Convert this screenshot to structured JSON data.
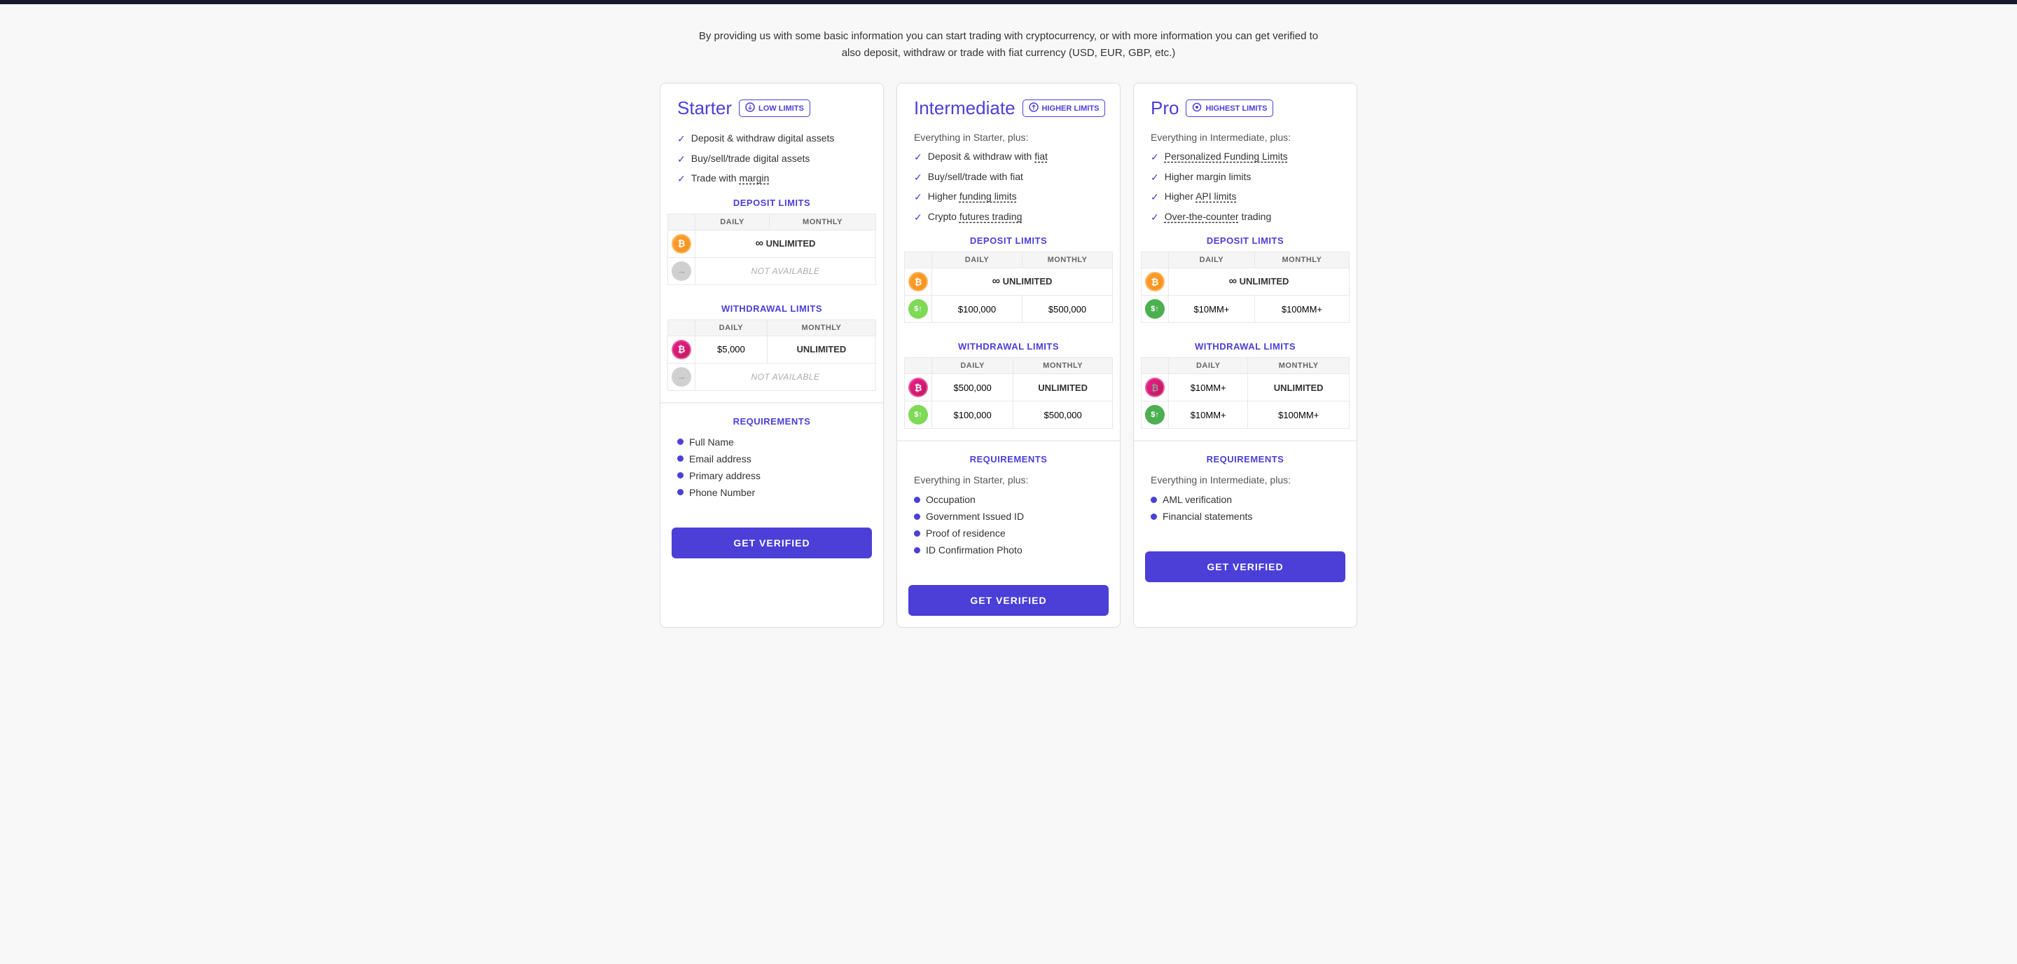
{
  "header": {
    "text": "By providing us with some basic information you can start trading with cryptocurrency, or with more information you can get verified to also deposit, withdraw or trade with fiat currency (USD, EUR, GBP, etc.)"
  },
  "cards": [
    {
      "id": "starter",
      "title": "Starter",
      "badge": "LOW LIMITS",
      "badge_icon": "↑",
      "features_prefix": null,
      "features": [
        "Deposit & withdraw digital assets",
        "Buy/sell/trade digital assets",
        "Trade with margin"
      ],
      "features_links": [
        null,
        null,
        "margin"
      ],
      "deposit_limits": {
        "title": "DEPOSIT LIMITS",
        "headers": [
          "DAILY",
          "MONTHLY"
        ],
        "rows": [
          {
            "icon": "btc-deposit",
            "icon_label": "₿",
            "daily": "∞ UNLIMITED",
            "monthly": null,
            "daily_type": "unlimited",
            "monthly_type": "merged"
          },
          {
            "icon": "grey",
            "icon_label": "→",
            "daily": "NOT AVAILABLE",
            "monthly": null,
            "daily_type": "not-available",
            "monthly_type": "merged"
          }
        ]
      },
      "withdrawal_limits": {
        "title": "WITHDRAWAL LIMITS",
        "headers": [
          "DAILY",
          "MONTHLY"
        ],
        "rows": [
          {
            "icon": "btc-withdraw",
            "icon_label": "₿",
            "daily": "$5,000",
            "monthly": "UNLIMITED",
            "daily_type": "amount",
            "monthly_type": "unlimited"
          },
          {
            "icon": "grey",
            "icon_label": "→",
            "daily": "NOT AVAILABLE",
            "monthly": null,
            "daily_type": "not-available",
            "monthly_type": "merged"
          }
        ]
      },
      "requirements": {
        "title": "REQUIREMENTS",
        "subtitle": null,
        "items": [
          "Full Name",
          "Email address",
          "Primary address",
          "Phone Number"
        ]
      },
      "button": "GET VERIFIED"
    },
    {
      "id": "intermediate",
      "title": "Intermediate",
      "badge": "HIGHER LIMITS",
      "badge_icon": "↑",
      "features_prefix": "Everything in Starter, plus:",
      "features": [
        "Deposit & withdraw with fiat",
        "Buy/sell/trade with fiat",
        "Higher funding limits",
        "Crypto futures trading"
      ],
      "features_links": [
        "fiat",
        null,
        "funding limits",
        "futures trading"
      ],
      "deposit_limits": {
        "title": "DEPOSIT LIMITS",
        "headers": [
          "DAILY",
          "MONTHLY"
        ],
        "rows": [
          {
            "icon": "btc-deposit",
            "icon_label": "₿",
            "daily": "∞ UNLIMITED",
            "monthly": null,
            "daily_type": "unlimited",
            "monthly_type": "merged"
          },
          {
            "icon": "fiat-deposit",
            "icon_label": "$",
            "daily": "$100,000",
            "monthly": "$500,000",
            "daily_type": "amount",
            "monthly_type": "amount"
          }
        ]
      },
      "withdrawal_limits": {
        "title": "WITHDRAWAL LIMITS",
        "headers": [
          "DAILY",
          "MONTHLY"
        ],
        "rows": [
          {
            "icon": "btc-withdraw",
            "icon_label": "₿",
            "daily": "$500,000",
            "monthly": "UNLIMITED",
            "daily_type": "amount",
            "monthly_type": "unlimited"
          },
          {
            "icon": "fiat-withdraw",
            "icon_label": "$",
            "daily": "$100,000",
            "monthly": "$500,000",
            "daily_type": "amount",
            "monthly_type": "amount"
          }
        ]
      },
      "requirements": {
        "title": "REQUIREMENTS",
        "subtitle": "Everything in Starter, plus:",
        "items": [
          "Occupation",
          "Government Issued ID",
          "Proof of residence",
          "ID Confirmation Photo"
        ]
      },
      "button": "GET VERIFIED"
    },
    {
      "id": "pro",
      "title": "Pro",
      "badge": "HIGHEST LIMITS",
      "badge_icon": "◎",
      "features_prefix": "Everything in Intermediate, plus:",
      "features": [
        "Personalized Funding Limits",
        "Higher margin limits",
        "Higher API limits",
        "Over-the-counter trading"
      ],
      "features_links": [
        "Personalized Funding Limits",
        null,
        "API limits",
        "Over-the-counter"
      ],
      "deposit_limits": {
        "title": "DEPOSIT LIMITS",
        "headers": [
          "DAILY",
          "MONTHLY"
        ],
        "rows": [
          {
            "icon": "btc-deposit",
            "icon_label": "₿",
            "daily": "∞ UNLIMITED",
            "monthly": null,
            "daily_type": "unlimited",
            "monthly_type": "merged"
          },
          {
            "icon": "fiat-deposit-pro",
            "icon_label": "$",
            "daily": "$10MM+",
            "monthly": "$100MM+",
            "daily_type": "amount",
            "monthly_type": "amount"
          }
        ]
      },
      "withdrawal_limits": {
        "title": "WITHDRAWAL LIMITS",
        "headers": [
          "DAILY",
          "MONTHLY"
        ],
        "rows": [
          {
            "icon": "btc-withdraw-pro",
            "icon_label": "₿",
            "daily": "$10MM+",
            "monthly": "UNLIMITED",
            "daily_type": "amount",
            "monthly_type": "unlimited"
          },
          {
            "icon": "fiat-withdraw-pro",
            "icon_label": "$",
            "daily": "$10MM+",
            "monthly": "$100MM+",
            "daily_type": "amount",
            "monthly_type": "amount"
          }
        ]
      },
      "requirements": {
        "title": "REQUIREMENTS",
        "subtitle": "Everything in Intermediate, plus:",
        "items": [
          "AML verification",
          "Financial statements"
        ]
      },
      "button": "GET VERIFIED"
    }
  ]
}
